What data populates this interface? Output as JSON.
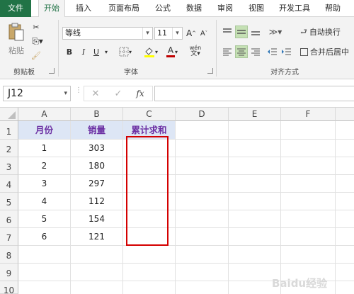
{
  "tabs": [
    {
      "label": "文件"
    },
    {
      "label": "开始"
    },
    {
      "label": "插入"
    },
    {
      "label": "页面布局"
    },
    {
      "label": "公式"
    },
    {
      "label": "数据"
    },
    {
      "label": "审阅"
    },
    {
      "label": "视图"
    },
    {
      "label": "开发工具"
    },
    {
      "label": "帮助"
    }
  ],
  "ribbon": {
    "clipboard": {
      "paste_label": "粘贴",
      "group_label": "剪贴板"
    },
    "font": {
      "font_name": "等线",
      "font_size": "11",
      "bold": "B",
      "italic": "I",
      "underline": "U",
      "grow": "A",
      "shrink": "A",
      "font_color": "A",
      "phonetic": "wén",
      "group_label": "字体"
    },
    "alignment": {
      "wrap_label": "自动换行",
      "merge_label": "合并后居中",
      "group_label": "对齐方式"
    }
  },
  "formula_bar": {
    "name_box": "J12",
    "cancel": "✕",
    "confirm": "✓",
    "fx": "fx",
    "value": ""
  },
  "columns": [
    "A",
    "B",
    "C",
    "D",
    "E",
    "F"
  ],
  "rows": [
    "1",
    "2",
    "3",
    "4",
    "5",
    "6",
    "7",
    "8",
    "9",
    "10"
  ],
  "table": {
    "headers": [
      "月份",
      "销量",
      "累计求和"
    ],
    "data": [
      [
        "1",
        "303"
      ],
      [
        "2",
        "180"
      ],
      [
        "3",
        "297"
      ],
      [
        "4",
        "112"
      ],
      [
        "5",
        "154"
      ],
      [
        "6",
        "121"
      ]
    ]
  },
  "watermark": "Baidu经验",
  "colors": {
    "accent": "#217346",
    "header_fill": "#dde6f5",
    "header_text": "#6b2fa3",
    "selection_box": "#d40000"
  }
}
